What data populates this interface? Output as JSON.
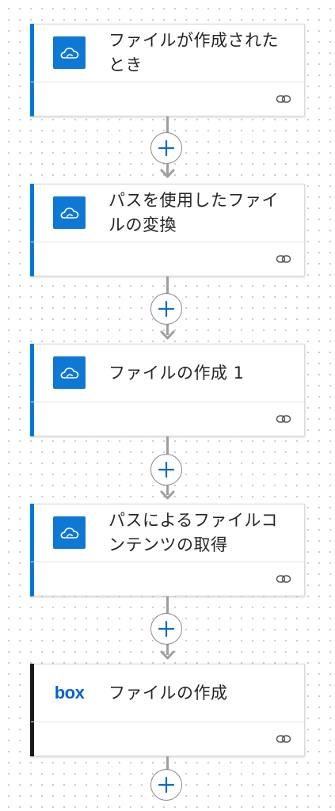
{
  "colors": {
    "onedrive_accent": "#0078d4",
    "onedrive_tile": "#0f78d4",
    "box_accent": "#1a1a1a",
    "box_brand": "#0061d5",
    "plus_blue": "#0f6cbd",
    "connector_gray": "#9e9e9e"
  },
  "steps": [
    {
      "title": "ファイルが作成されたとき",
      "icon": "onedrive-cloud-icon",
      "service": "onedrive"
    },
    {
      "title": "パスを使用したファイルの変換",
      "icon": "onedrive-cloud-icon",
      "service": "onedrive"
    },
    {
      "title": "ファイルの作成 1",
      "icon": "onedrive-cloud-icon",
      "service": "onedrive"
    },
    {
      "title": "パスによるファイルコンテンツの取得",
      "icon": "onedrive-cloud-icon",
      "service": "onedrive"
    },
    {
      "title": "ファイルの作成",
      "icon": "box-logo-icon",
      "service": "box",
      "logo_text": "box"
    }
  ],
  "footer_link_icon": "link-icon",
  "insert_step_icon": "plus-icon"
}
